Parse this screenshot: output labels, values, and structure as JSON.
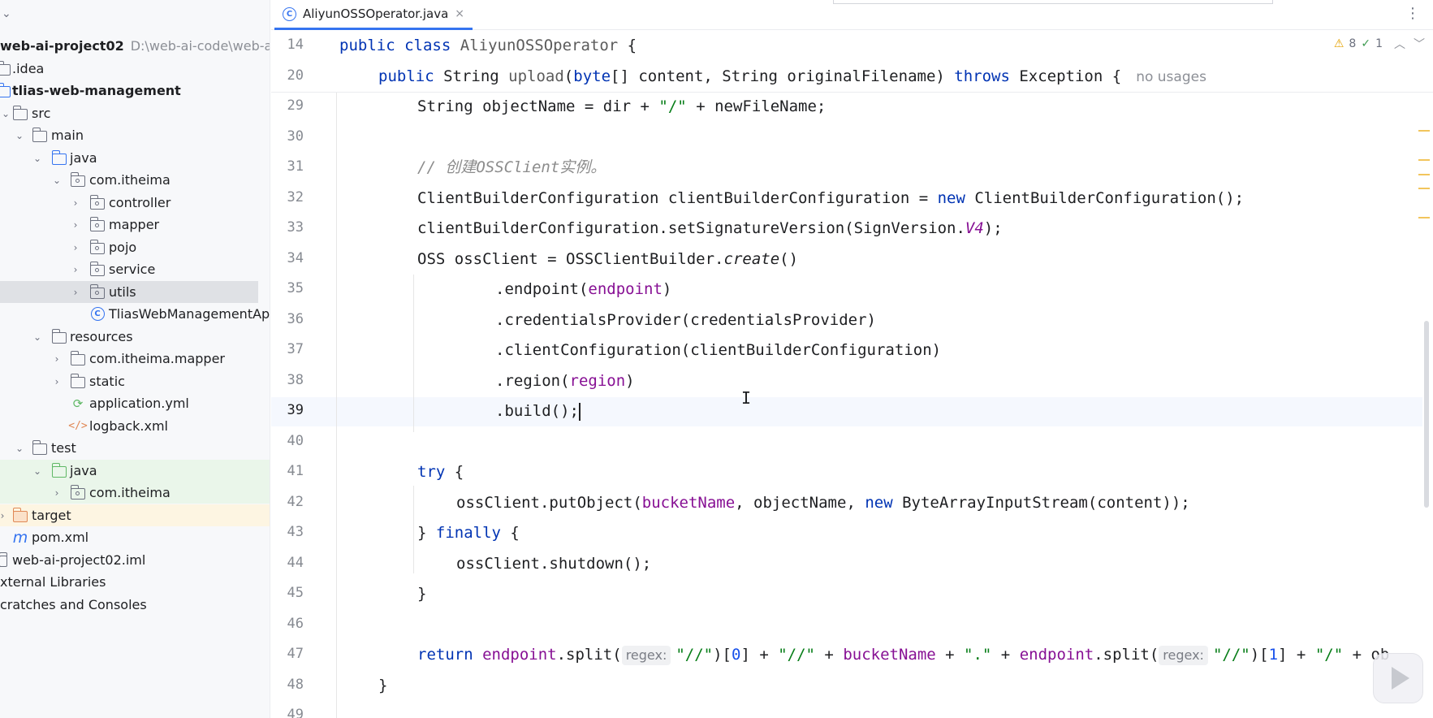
{
  "sidebar": {
    "items": [
      {
        "label": "web-ai-project02",
        "hint": "D:\\web-ai-code\\web-ai-p"
      },
      {
        "label": ".idea"
      },
      {
        "label": "tlias-web-management"
      },
      {
        "label": "src"
      },
      {
        "label": "main"
      },
      {
        "label": "java"
      },
      {
        "label": "com.itheima"
      },
      {
        "label": "controller"
      },
      {
        "label": "mapper"
      },
      {
        "label": "pojo"
      },
      {
        "label": "service"
      },
      {
        "label": "utils"
      },
      {
        "label": "TliasWebManagementApp"
      },
      {
        "label": "resources"
      },
      {
        "label": "com.itheima.mapper"
      },
      {
        "label": "static"
      },
      {
        "label": "application.yml"
      },
      {
        "label": "logback.xml"
      },
      {
        "label": "test"
      },
      {
        "label": "java"
      },
      {
        "label": "com.itheima"
      },
      {
        "label": "target"
      },
      {
        "label": "pom.xml"
      },
      {
        "label": "web-ai-project02.iml"
      },
      {
        "label": "xternal Libraries"
      },
      {
        "label": "cratches and Consoles"
      }
    ]
  },
  "editor": {
    "tab": {
      "label": "AliyunOSSOperator.java",
      "icon": "class-icon",
      "close": "×"
    },
    "inspections": {
      "warnings": "8",
      "checks": "1"
    },
    "sticky": {
      "line14_num": "14",
      "line14_kw1": "public",
      "line14_kw2": "class",
      "line14_name": "AliyunOSSOperator",
      "line14_rest": " {",
      "line20_num": "20",
      "line20_kw1": "public",
      "line20_t1": " String ",
      "line20_method": "upload",
      "line20_t2": "(",
      "line20_kw2": "byte",
      "line20_t3": "[] content, String originalFilename) ",
      "line20_kw3": "throws",
      "line20_t4": " Exception {",
      "usage": "no usages"
    },
    "line_numbers": [
      "29",
      "30",
      "31",
      "32",
      "33",
      "34",
      "35",
      "36",
      "37",
      "38",
      "39",
      "40",
      "41",
      "42",
      "43",
      "44",
      "45",
      "46",
      "47",
      "48",
      "49"
    ],
    "code": {
      "l29": [
        "String objectName = dir + ",
        "\"/\"",
        " + newFileName;"
      ],
      "l31": "// 创建OSSClient实例。",
      "l32": [
        "ClientBuilderConfiguration clientBuilderConfiguration = ",
        "new",
        " ClientBuilderConfiguration();"
      ],
      "l33": [
        "clientBuilderConfiguration.setSignatureVersion(SignVersion.",
        "V4",
        ");"
      ],
      "l34": [
        "OSS ossClient = OSSClientBuilder.",
        "create",
        "()"
      ],
      "l35": [
        ".endpoint(",
        "endpoint",
        ")"
      ],
      "l36": ".credentialsProvider(credentialsProvider)",
      "l37": ".clientConfiguration(clientBuilderConfiguration)",
      "l38": [
        ".region(",
        "region",
        ")"
      ],
      "l39": ".build();",
      "l41": [
        "try",
        " {"
      ],
      "l42": [
        "ossClient.putObject(",
        "bucketName",
        ", objectName, ",
        "new",
        " ByteArrayInputStream(content));"
      ],
      "l43": [
        "} ",
        "finally",
        " {"
      ],
      "l44": "ossClient.shutdown();",
      "l45": "}",
      "l47": {
        "kw": "return",
        "f1": "endpoint",
        "t1": ".split(",
        "hint1": "regex:",
        "s1": "\"//\"",
        "t2": ")[",
        "n0": "0",
        "t3": "] + ",
        "s2": "\"//\"",
        "t4": " + ",
        "f2": "bucketName",
        "t5": " + ",
        "s3": "\".\"",
        "t6": " + ",
        "f3": "endpoint",
        "t7": ".split(",
        "hint2": "regex:",
        "s4": "\"//\"",
        "t8": ")[",
        "n1": "1",
        "t9": "] + ",
        "s5": "\"/\"",
        "t10": " + ob"
      },
      "l48": "}"
    }
  },
  "colors": {
    "keyword": "#0033b3",
    "string": "#067d17",
    "number": "#1750eb",
    "field": "#871094",
    "comment": "#8c8c8c",
    "accent": "#3574f0"
  }
}
